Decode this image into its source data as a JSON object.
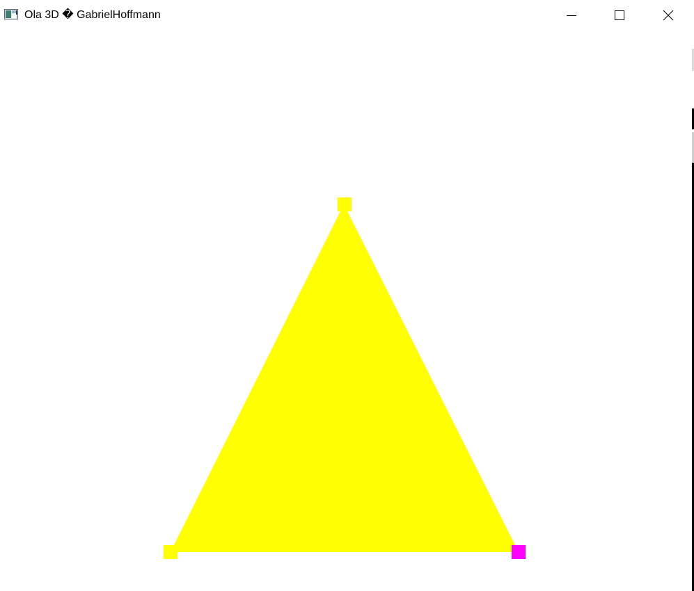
{
  "window": {
    "title": "Ola 3D � GabrielHoffmann",
    "icons": {
      "app": "window-app-icon",
      "minimize": "minimize-icon",
      "maximize": "maximize-icon",
      "close": "close-icon"
    }
  },
  "scene": {
    "triangle_color": "#ffff00",
    "vertex_markers": [
      {
        "name": "top-vertex",
        "color": "#ffff00"
      },
      {
        "name": "bottom-left-vertex",
        "color": "#ffff00"
      },
      {
        "name": "bottom-right-vertex",
        "color": "#ff00ff"
      }
    ],
    "background_color": "#ffffff"
  }
}
